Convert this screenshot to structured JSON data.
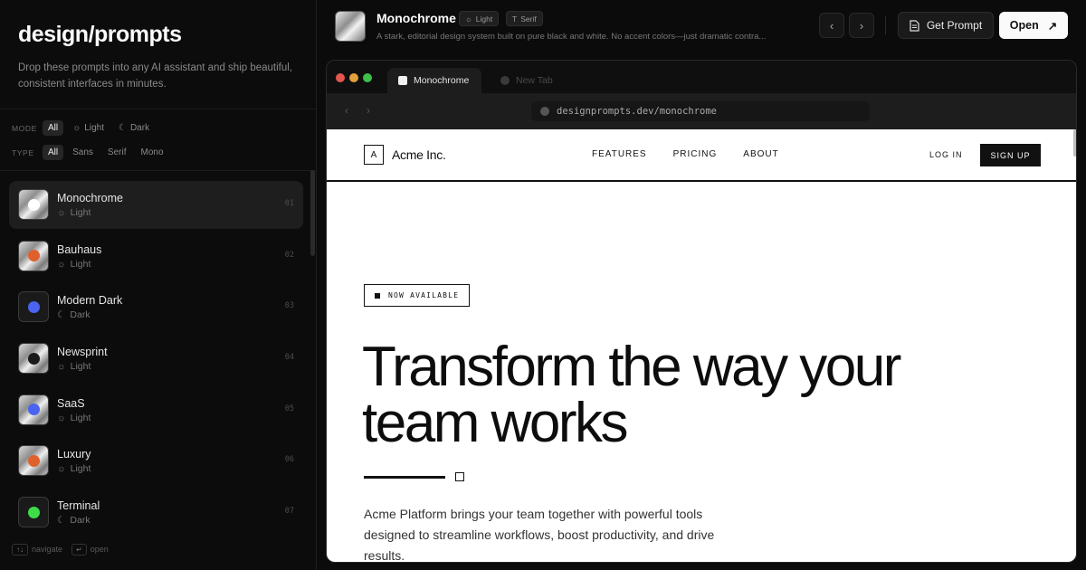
{
  "sidebar": {
    "brand": "design/prompts",
    "tagline": "Drop these prompts into any AI assistant and ship beautiful, consistent interfaces in minutes.",
    "mode_filter": {
      "label": "MODE",
      "options": [
        "All",
        "Light",
        "Dark"
      ],
      "selected": "All"
    },
    "type_filter": {
      "label": "TYPE",
      "options": [
        "All",
        "Sans",
        "Serif",
        "Mono"
      ],
      "selected": "All"
    },
    "items": [
      {
        "name": "Monochrome",
        "mode": "Light",
        "num": "01",
        "dot": "#ffffff",
        "thumb": "metal"
      },
      {
        "name": "Bauhaus",
        "mode": "Light",
        "num": "02",
        "dot": "#e0602c",
        "thumb": "metal"
      },
      {
        "name": "Modern Dark",
        "mode": "Dark",
        "num": "03",
        "dot": "#4a63f0",
        "thumb": "dark"
      },
      {
        "name": "Newsprint",
        "mode": "Light",
        "num": "04",
        "dot": "#1a1a1a",
        "thumb": "metal"
      },
      {
        "name": "SaaS",
        "mode": "Light",
        "num": "05",
        "dot": "#4a63f0",
        "thumb": "metal"
      },
      {
        "name": "Luxury",
        "mode": "Light",
        "num": "06",
        "dot": "#e0602c",
        "thumb": "metal"
      },
      {
        "name": "Terminal",
        "mode": "Dark",
        "num": "07",
        "dot": "#3ddc48",
        "thumb": "dark"
      }
    ],
    "footer": {
      "navigate_key": "↑↓",
      "navigate_label": "navigate",
      "open_key": "↵",
      "open_label": "open"
    }
  },
  "topbar": {
    "title": "Monochrome",
    "badge_mode": "Light",
    "badge_type": "Serif",
    "description": "A stark, editorial design system built on pure black and white. No accent colors—just dramatic contra...",
    "get_prompt_label": "Get Prompt",
    "open_label": "Open"
  },
  "browser": {
    "active_tab": "Monochrome",
    "inactive_tab": "New Tab",
    "url": "designprompts.dev/monochrome"
  },
  "site": {
    "logo_mark": "A",
    "logo_text": "Acme Inc.",
    "nav": [
      "FEATURES",
      "PRICING",
      "ABOUT"
    ],
    "login": "LOG IN",
    "signup": "SIGN UP",
    "badge": "NOW AVAILABLE",
    "headline_line1": "Transform the way your",
    "headline_line2": "team works",
    "lede": "Acme Platform brings your team together with powerful tools designed to streamline workflows, boost productivity, and drive results."
  },
  "colors": {
    "traffic_red": "#e5564f",
    "traffic_yellow": "#e0a23a",
    "traffic_green": "#3fbf49"
  }
}
